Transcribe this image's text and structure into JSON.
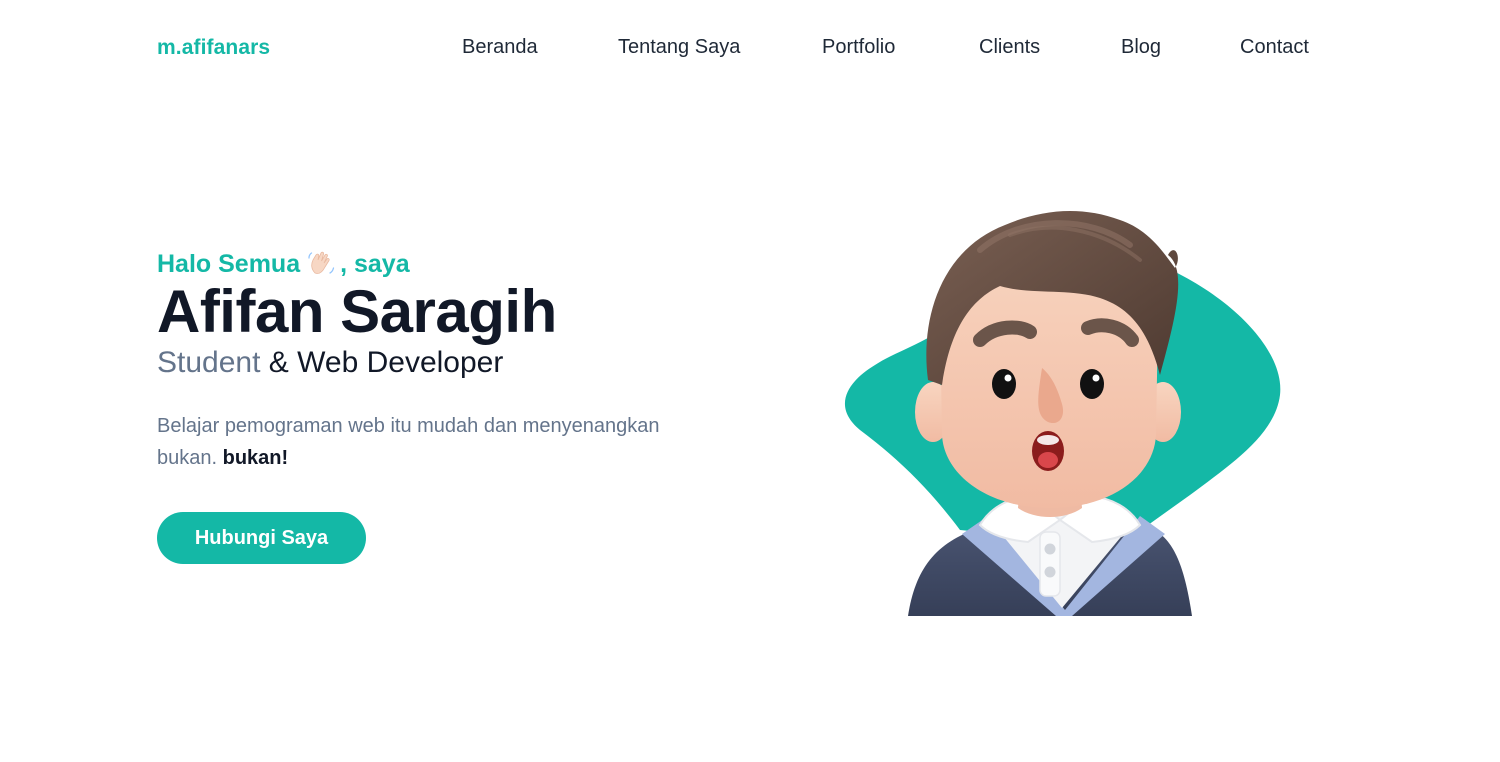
{
  "brand": {
    "name": "m.afifanars"
  },
  "nav": {
    "items": [
      {
        "label": "Beranda"
      },
      {
        "label": "Tentang Saya"
      },
      {
        "label": "Portfolio"
      },
      {
        "label": "Clients"
      },
      {
        "label": "Blog"
      },
      {
        "label": "Contact"
      }
    ]
  },
  "hero": {
    "greeting_prefix": "Halo Semua",
    "greeting_icon": "waving-hand-icon",
    "greeting_suffix": ", saya",
    "name": "Afifan Saragih",
    "role_primary": "Student",
    "role_secondary": "& Web Developer",
    "description": "Belajar pemograman web itu mudah dan menyenangkan bukan.",
    "description_emphasis": "bukan!",
    "cta_label": "Hubungi Saya",
    "illustration": "3d-avatar-boy-illustration"
  },
  "colors": {
    "accent": "#14b8a6",
    "heading": "#111827",
    "muted": "#64748b",
    "background": "#ffffff"
  }
}
